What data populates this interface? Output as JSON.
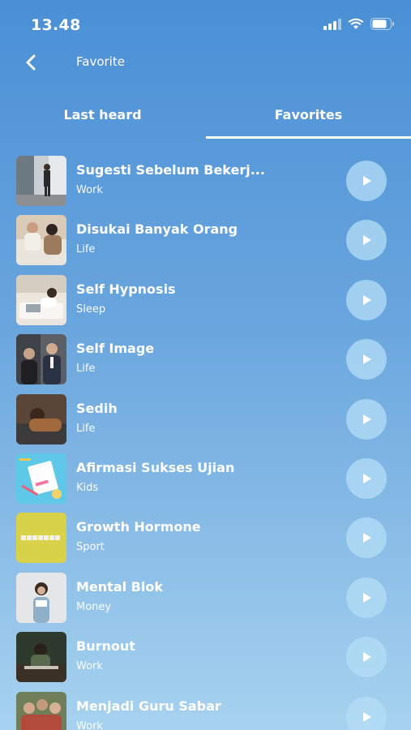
{
  "status": {
    "time": "13.48"
  },
  "header": {
    "title": "Favorite",
    "back_icon": "chevron-left-icon"
  },
  "tabs": [
    {
      "label": "Last heard",
      "active": false
    },
    {
      "label": "Favorites",
      "active": true
    }
  ],
  "items": [
    {
      "title": "Sugesti Sebelum Bekerj...",
      "category": "Work"
    },
    {
      "title": "Disukai Banyak Orang",
      "category": "Life"
    },
    {
      "title": "Self Hypnosis",
      "category": "Sleep"
    },
    {
      "title": "Self Image",
      "category": "Life"
    },
    {
      "title": "Sedih",
      "category": "Life"
    },
    {
      "title": "Afirmasi Sukses Ujian",
      "category": "Kids"
    },
    {
      "title": "Growth Hormone",
      "category": "Sport"
    },
    {
      "title": "Mental Blok",
      "category": "Money"
    },
    {
      "title": "Burnout",
      "category": "Work"
    },
    {
      "title": "Menjadi Guru Sabar",
      "category": "Work"
    }
  ],
  "colors": {
    "bg_top": "#4a8fd6",
    "bg_bottom": "#a7d2ef",
    "play_bg": "#b4def6"
  }
}
